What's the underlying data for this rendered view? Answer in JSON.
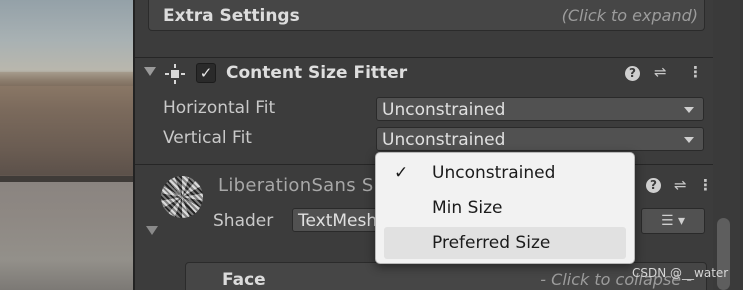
{
  "extra_settings": {
    "title": "Extra Settings",
    "hint": "(Click to expand)"
  },
  "component": {
    "title": "Content Size Fitter",
    "enabled": true,
    "check_glyph": "✓",
    "icons": {
      "fold": "foldout-triangle",
      "component": "content-size-fitter-icon",
      "help": "help-icon",
      "presets": "presets-icon",
      "menu": "kebab-menu-icon"
    },
    "help_glyph": "?",
    "presets_glyph": "⇌",
    "menu_glyph": "⋮",
    "fields": [
      {
        "label": "Horizontal Fit",
        "value": "Unconstrained"
      },
      {
        "label": "Vertical Fit",
        "value": "Unconstrained"
      }
    ]
  },
  "material": {
    "name": "LiberationSans S",
    "shader_label": "Shader",
    "shader_value": "TextMesh",
    "face": {
      "title": "Face",
      "hint": "- Click to collapse -"
    },
    "edit_glyph": "☰ ▾"
  },
  "dropdown_menu": {
    "selected": "Unconstrained",
    "items": [
      {
        "label": "Unconstrained",
        "checked": true,
        "check": "✓"
      },
      {
        "label": "Min Size",
        "checked": false,
        "check": ""
      },
      {
        "label": "Preferred Size",
        "checked": false,
        "check": "",
        "hovered": true
      }
    ]
  },
  "watermark": "CSDN @__water"
}
